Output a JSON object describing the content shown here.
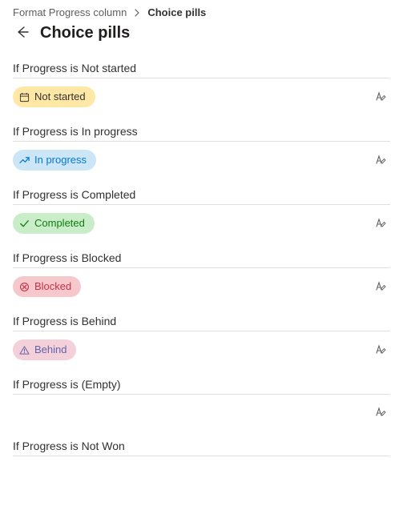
{
  "breadcrumb": {
    "parent": "Format Progress column",
    "current": "Choice pills"
  },
  "title": "Choice pills",
  "column_name": "Progress",
  "rule_prefix": "If Progress is ",
  "rules": [
    {
      "value": "Not started",
      "pill_text": "Not started",
      "pill_variant": "yellow",
      "icon": "calendar"
    },
    {
      "value": "In progress",
      "pill_text": "In progress",
      "pill_variant": "blue",
      "icon": "trend"
    },
    {
      "value": "Completed",
      "pill_text": "Completed",
      "pill_variant": "green",
      "icon": "check"
    },
    {
      "value": "Blocked",
      "pill_text": "Blocked",
      "pill_variant": "red",
      "icon": "blocked"
    },
    {
      "value": "Behind",
      "pill_text": "Behind",
      "pill_variant": "pink",
      "icon": "warning"
    },
    {
      "value": "(Empty)",
      "pill_text": "",
      "pill_variant": "none",
      "icon": ""
    },
    {
      "value": "Not Won",
      "pill_text": "",
      "pill_variant": "none",
      "icon": ""
    }
  ]
}
